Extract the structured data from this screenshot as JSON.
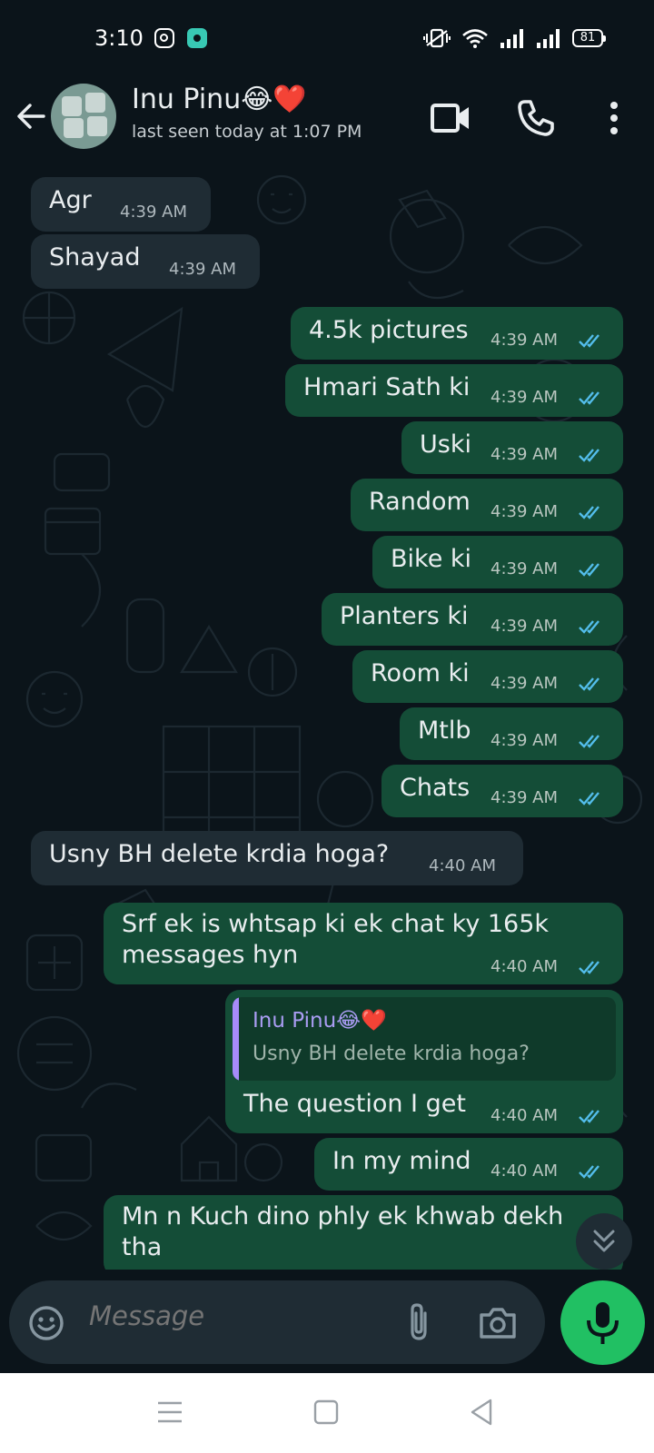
{
  "status_bar": {
    "time": "3:10",
    "battery": "81"
  },
  "header": {
    "contact_name": "Inu Pinu😂❤️",
    "last_seen": "last seen today at 1:07 PM"
  },
  "messages": [
    {
      "dir": "in",
      "text": "Agr",
      "time": "4:39 AM"
    },
    {
      "dir": "in",
      "text": "Shayad",
      "time": "4:39 AM"
    },
    {
      "dir": "out",
      "text": "4.5k pictures",
      "time": "4:39 AM"
    },
    {
      "dir": "out",
      "text": "Hmari Sath ki",
      "time": "4:39 AM"
    },
    {
      "dir": "out",
      "text": "Uski",
      "time": "4:39 AM"
    },
    {
      "dir": "out",
      "text": "Random",
      "time": "4:39 AM"
    },
    {
      "dir": "out",
      "text": "Bike ki",
      "time": "4:39 AM"
    },
    {
      "dir": "out",
      "text": "Planters ki",
      "time": "4:39 AM"
    },
    {
      "dir": "out",
      "text": "Room ki",
      "time": "4:39 AM"
    },
    {
      "dir": "out",
      "text": "Mtlb",
      "time": "4:39 AM"
    },
    {
      "dir": "out",
      "text": "Chats",
      "time": "4:39 AM"
    },
    {
      "dir": "in",
      "text": "Usny BH delete krdia hoga?",
      "time": "4:40 AM"
    },
    {
      "dir": "out",
      "text_line1": "Srf ek is whtsap ki ek chat ky 165k",
      "text_line2": "messages hyn",
      "time": "4:40 AM"
    },
    {
      "dir": "out",
      "quote_name": "Inu Pinu😂❤️",
      "quote_text": "Usny BH delete krdia hoga?",
      "text": "The question I get",
      "time": "4:40 AM"
    },
    {
      "dir": "out",
      "text": "In my mind",
      "time": "4:40 AM"
    },
    {
      "dir": "out",
      "text": "Mn n Kuch dino phly ek khwab dekh",
      "text_partial": "tha"
    }
  ],
  "input": {
    "placeholder": "Message"
  },
  "colors": {
    "background": "#0b141a",
    "incoming_bubble": "#1f2c34",
    "outgoing_bubble": "#144d37",
    "read_tick": "#53bdeb",
    "mic_button": "#21c063"
  },
  "icons": [
    "back-arrow-icon",
    "video-call-icon",
    "phone-icon",
    "more-vert-icon",
    "emoji-icon",
    "attach-icon",
    "camera-icon",
    "mic-icon",
    "scroll-down-icon"
  ]
}
